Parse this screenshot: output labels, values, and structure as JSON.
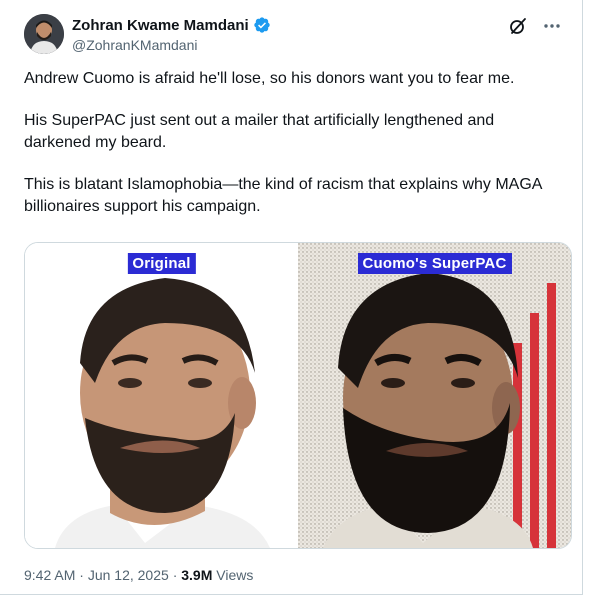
{
  "author": {
    "display_name": "Zohran Kwame Mamdani",
    "handle": "@ZohranKMamdani"
  },
  "tweet": {
    "paragraphs": [
      "Andrew Cuomo is afraid he'll lose, so his donors want you to fear me.",
      "His SuperPAC just sent out a mailer that artificially lengthened and darkened my beard.",
      "This is blatant Islamophobia—the kind of racism that explains why MAGA billionaires support his campaign."
    ]
  },
  "media": {
    "left_label": "Original",
    "right_label": "Cuomo's SuperPAC"
  },
  "meta": {
    "time": "9:42 AM",
    "date": "Jun 12, 2025",
    "views_count": "3.9M",
    "views_label": "Views"
  },
  "colors": {
    "verified": "#1d9bf0",
    "label_bg": "#2b2bd4",
    "bars": "#d6333a"
  },
  "icons": {
    "verified": "verified-badge-icon",
    "grok": "grok-icon",
    "more": "more-horizontal-icon"
  }
}
